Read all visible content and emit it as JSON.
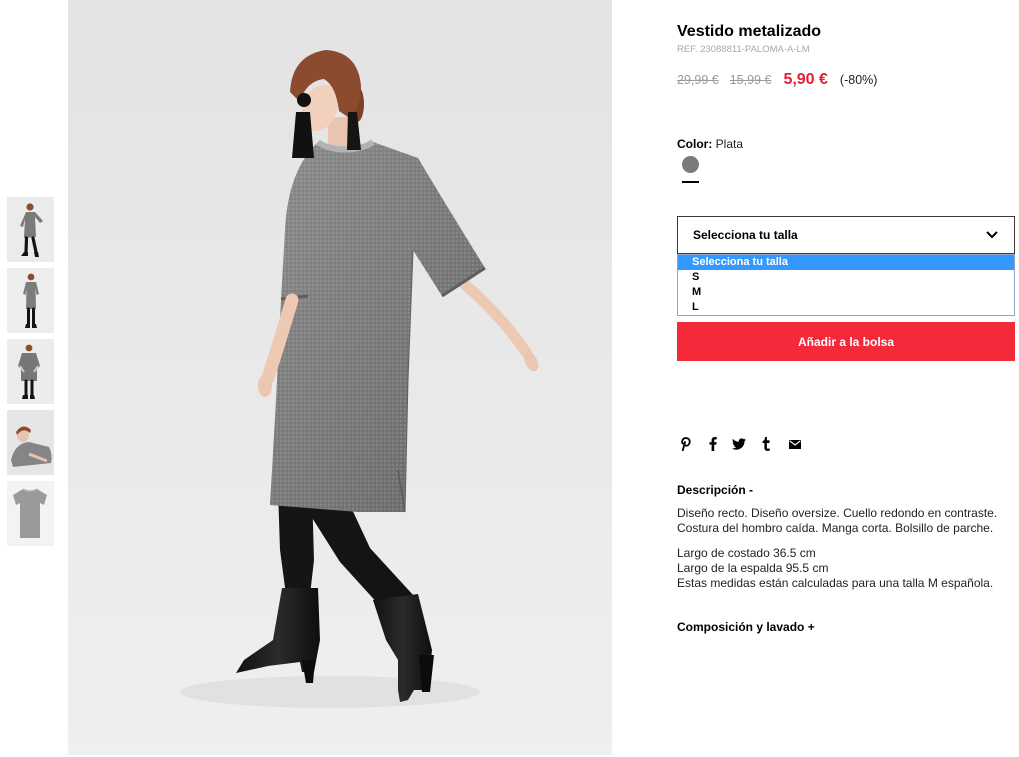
{
  "product": {
    "title": "Vestido metalizado",
    "reference": "REF. 23088811-PALOMA-A-LM",
    "price": {
      "original": "29,99 €",
      "previous": "15,99 €",
      "current": "5,90 €",
      "discount": "(-80%)"
    },
    "color": {
      "label": "Color:",
      "value": "Plata",
      "swatch": "#7b7b7b"
    },
    "size": {
      "selected": "Selecciona tu talla",
      "options": [
        "Selecciona tu talla",
        "S",
        "M",
        "L"
      ],
      "highlighted_index": 0,
      "icon": "chevron-down-icon"
    },
    "add_to_bag": "Añadir a la bolsa",
    "share_icons": [
      "pinterest-icon",
      "facebook-icon",
      "twitter-icon",
      "tumblr-icon",
      "mail-icon"
    ],
    "description": {
      "heading": "Descripción -",
      "paragraphs": [
        [
          "Diseño recto. Diseño oversize. Cuello redondo en contraste.",
          "Costura del hombro caída. Manga corta. Bolsillo de parche."
        ],
        [
          "Largo de costado 36.5 cm",
          "Largo de la espalda 95.5 cm",
          "Estas medidas están calculadas para una talla M española."
        ]
      ]
    },
    "composition": {
      "heading": "Composición y lavado +"
    }
  },
  "theme": {
    "sale_price": "#e61e36",
    "button_bg": "#f42a3b",
    "button_text": "#ffffff",
    "option_highlight": "#3399ff",
    "strike_price": "#9b9b9b",
    "text": "#000000"
  }
}
